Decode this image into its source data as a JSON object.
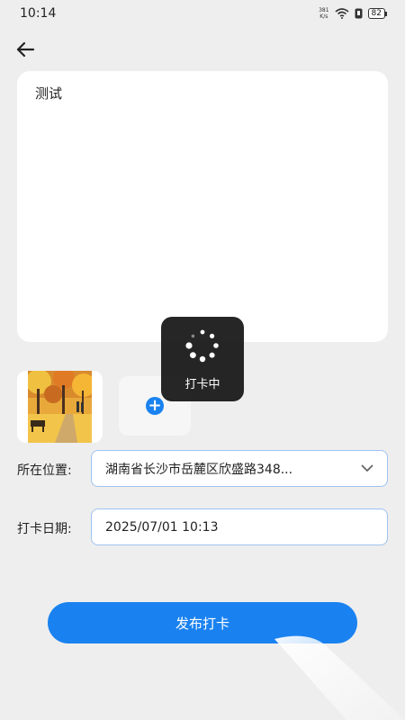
{
  "status_bar": {
    "time": "10:14",
    "net_speed_value": "381",
    "net_speed_unit": "K/s",
    "battery": "82"
  },
  "note": {
    "content": "测试"
  },
  "loading": {
    "text": "打卡中"
  },
  "form": {
    "location_label": "所在位置:",
    "location_value": "湖南省长沙市岳麓区欣盛路348...",
    "date_label": "打卡日期:",
    "date_value": "2025/07/01 10:13"
  },
  "submit": {
    "label": "发布打卡"
  },
  "colors": {
    "accent": "#1a82f0",
    "background": "#eeeeee",
    "field_border": "#9fc3f0"
  },
  "icons": {
    "back": "arrow-left-icon",
    "add": "plus-circle-icon",
    "dropdown": "chevron-down-icon",
    "spinner": "loading-spinner-icon"
  }
}
